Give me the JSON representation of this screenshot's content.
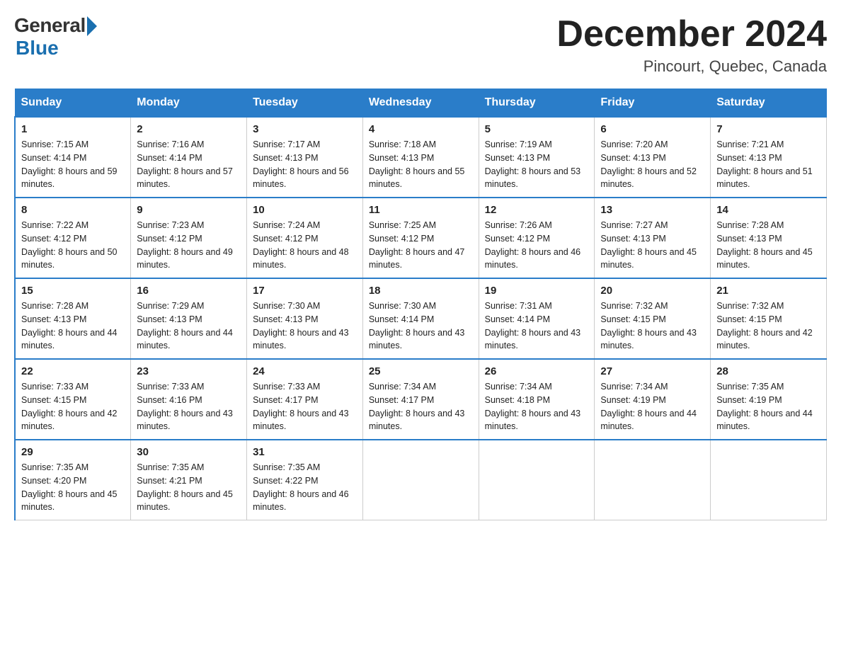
{
  "header": {
    "logo_general": "General",
    "logo_blue": "Blue",
    "month_title": "December 2024",
    "location": "Pincourt, Quebec, Canada"
  },
  "days_of_week": [
    "Sunday",
    "Monday",
    "Tuesday",
    "Wednesday",
    "Thursday",
    "Friday",
    "Saturday"
  ],
  "weeks": [
    [
      {
        "day": 1,
        "sunrise": "7:15 AM",
        "sunset": "4:14 PM",
        "daylight": "8 hours and 59 minutes."
      },
      {
        "day": 2,
        "sunrise": "7:16 AM",
        "sunset": "4:14 PM",
        "daylight": "8 hours and 57 minutes."
      },
      {
        "day": 3,
        "sunrise": "7:17 AM",
        "sunset": "4:13 PM",
        "daylight": "8 hours and 56 minutes."
      },
      {
        "day": 4,
        "sunrise": "7:18 AM",
        "sunset": "4:13 PM",
        "daylight": "8 hours and 55 minutes."
      },
      {
        "day": 5,
        "sunrise": "7:19 AM",
        "sunset": "4:13 PM",
        "daylight": "8 hours and 53 minutes."
      },
      {
        "day": 6,
        "sunrise": "7:20 AM",
        "sunset": "4:13 PM",
        "daylight": "8 hours and 52 minutes."
      },
      {
        "day": 7,
        "sunrise": "7:21 AM",
        "sunset": "4:13 PM",
        "daylight": "8 hours and 51 minutes."
      }
    ],
    [
      {
        "day": 8,
        "sunrise": "7:22 AM",
        "sunset": "4:12 PM",
        "daylight": "8 hours and 50 minutes."
      },
      {
        "day": 9,
        "sunrise": "7:23 AM",
        "sunset": "4:12 PM",
        "daylight": "8 hours and 49 minutes."
      },
      {
        "day": 10,
        "sunrise": "7:24 AM",
        "sunset": "4:12 PM",
        "daylight": "8 hours and 48 minutes."
      },
      {
        "day": 11,
        "sunrise": "7:25 AM",
        "sunset": "4:12 PM",
        "daylight": "8 hours and 47 minutes."
      },
      {
        "day": 12,
        "sunrise": "7:26 AM",
        "sunset": "4:12 PM",
        "daylight": "8 hours and 46 minutes."
      },
      {
        "day": 13,
        "sunrise": "7:27 AM",
        "sunset": "4:13 PM",
        "daylight": "8 hours and 45 minutes."
      },
      {
        "day": 14,
        "sunrise": "7:28 AM",
        "sunset": "4:13 PM",
        "daylight": "8 hours and 45 minutes."
      }
    ],
    [
      {
        "day": 15,
        "sunrise": "7:28 AM",
        "sunset": "4:13 PM",
        "daylight": "8 hours and 44 minutes."
      },
      {
        "day": 16,
        "sunrise": "7:29 AM",
        "sunset": "4:13 PM",
        "daylight": "8 hours and 44 minutes."
      },
      {
        "day": 17,
        "sunrise": "7:30 AM",
        "sunset": "4:13 PM",
        "daylight": "8 hours and 43 minutes."
      },
      {
        "day": 18,
        "sunrise": "7:30 AM",
        "sunset": "4:14 PM",
        "daylight": "8 hours and 43 minutes."
      },
      {
        "day": 19,
        "sunrise": "7:31 AM",
        "sunset": "4:14 PM",
        "daylight": "8 hours and 43 minutes."
      },
      {
        "day": 20,
        "sunrise": "7:32 AM",
        "sunset": "4:15 PM",
        "daylight": "8 hours and 43 minutes."
      },
      {
        "day": 21,
        "sunrise": "7:32 AM",
        "sunset": "4:15 PM",
        "daylight": "8 hours and 42 minutes."
      }
    ],
    [
      {
        "day": 22,
        "sunrise": "7:33 AM",
        "sunset": "4:15 PM",
        "daylight": "8 hours and 42 minutes."
      },
      {
        "day": 23,
        "sunrise": "7:33 AM",
        "sunset": "4:16 PM",
        "daylight": "8 hours and 43 minutes."
      },
      {
        "day": 24,
        "sunrise": "7:33 AM",
        "sunset": "4:17 PM",
        "daylight": "8 hours and 43 minutes."
      },
      {
        "day": 25,
        "sunrise": "7:34 AM",
        "sunset": "4:17 PM",
        "daylight": "8 hours and 43 minutes."
      },
      {
        "day": 26,
        "sunrise": "7:34 AM",
        "sunset": "4:18 PM",
        "daylight": "8 hours and 43 minutes."
      },
      {
        "day": 27,
        "sunrise": "7:34 AM",
        "sunset": "4:19 PM",
        "daylight": "8 hours and 44 minutes."
      },
      {
        "day": 28,
        "sunrise": "7:35 AM",
        "sunset": "4:19 PM",
        "daylight": "8 hours and 44 minutes."
      }
    ],
    [
      {
        "day": 29,
        "sunrise": "7:35 AM",
        "sunset": "4:20 PM",
        "daylight": "8 hours and 45 minutes."
      },
      {
        "day": 30,
        "sunrise": "7:35 AM",
        "sunset": "4:21 PM",
        "daylight": "8 hours and 45 minutes."
      },
      {
        "day": 31,
        "sunrise": "7:35 AM",
        "sunset": "4:22 PM",
        "daylight": "8 hours and 46 minutes."
      },
      null,
      null,
      null,
      null
    ]
  ]
}
